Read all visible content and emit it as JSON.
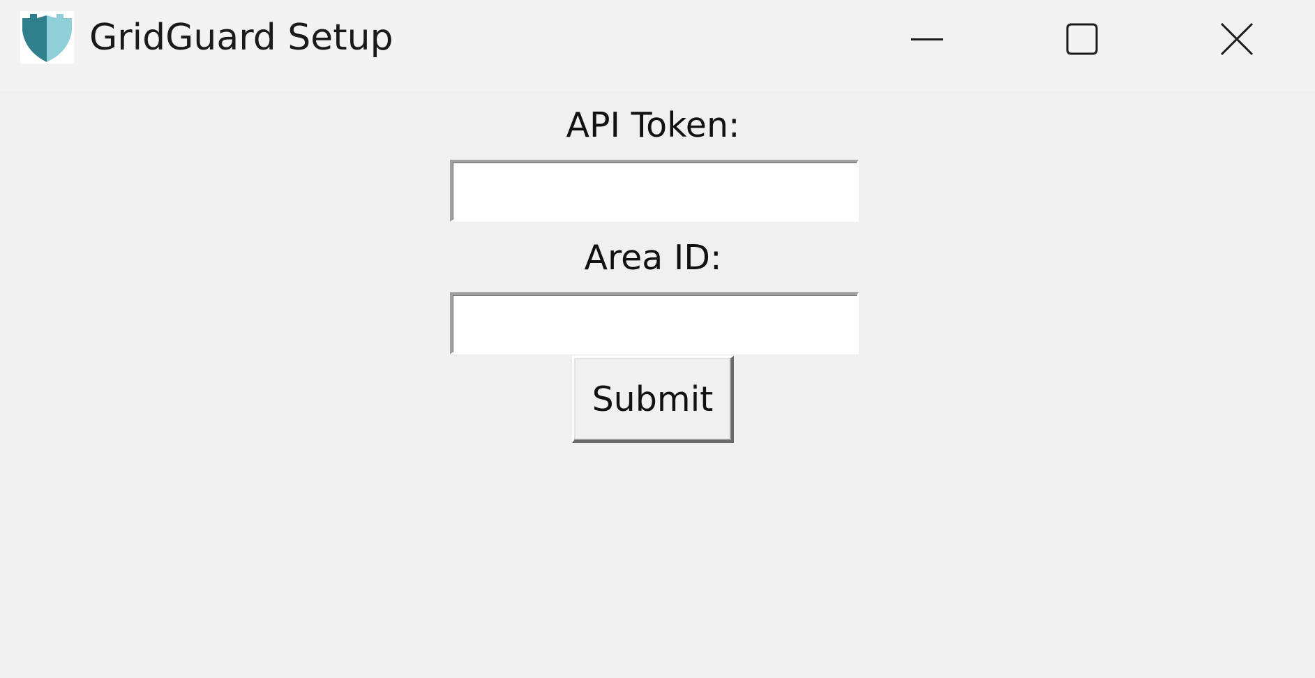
{
  "window": {
    "title": "GridGuard Setup",
    "icon": "shield-icon",
    "controls": {
      "minimize": "minimize-icon",
      "maximize": "maximize-icon",
      "close": "close-icon"
    }
  },
  "form": {
    "api_token": {
      "label": "API Token:",
      "value": "",
      "placeholder": ""
    },
    "area_id": {
      "label": "Area ID:",
      "value": "",
      "placeholder": ""
    },
    "submit_label": "Submit"
  },
  "colors": {
    "shield_dark": "#2f7f8c",
    "shield_light": "#8fcfd8",
    "background": "#f0f0f0"
  }
}
